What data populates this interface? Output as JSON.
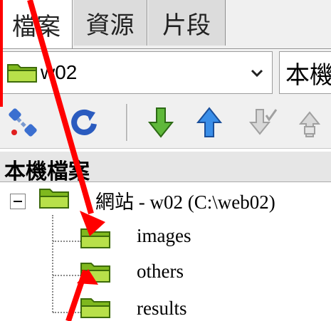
{
  "tabs": [
    {
      "label": "檔案",
      "active": true
    },
    {
      "label": "資源",
      "active": false
    },
    {
      "label": "片段",
      "active": false
    }
  ],
  "location": {
    "site_value": "w02",
    "view_value": "本機"
  },
  "toolbar": {
    "buttons": [
      "connect-icon",
      "refresh-icon",
      "get-icon",
      "put-icon",
      "check-in-icon",
      "check-out-icon"
    ]
  },
  "header": {
    "label": "本機檔案"
  },
  "tree": {
    "root": "網站 - w02 (C:\\web02)",
    "children": [
      "images",
      "others",
      "results"
    ]
  },
  "colors": {
    "annotation": "#ff0000",
    "folder": "#9bd22a"
  }
}
